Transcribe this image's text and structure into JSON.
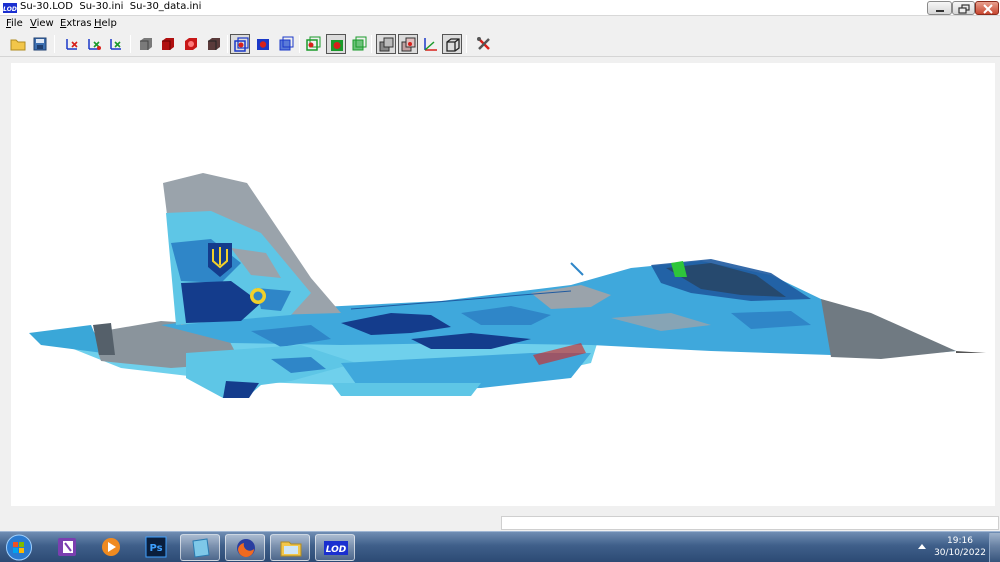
{
  "window": {
    "title": "Su-30.LOD  Su-30.ini  Su-30_data.ini",
    "app_badge": "LOD"
  },
  "menu": {
    "items": [
      {
        "label": "File"
      },
      {
        "label": "View"
      },
      {
        "label": "Extras"
      },
      {
        "label": "Help"
      }
    ]
  },
  "toolbar": {
    "buttons": [
      {
        "icon": "open-folder-icon"
      },
      {
        "icon": "save-disk-icon"
      },
      {
        "icon": "axis-x-icon"
      },
      {
        "icon": "axis-y-icon"
      },
      {
        "icon": "axis-z-icon"
      },
      {
        "icon": "cube-gray-icon"
      },
      {
        "icon": "cube-red-icon"
      },
      {
        "icon": "cube-red-alt-icon"
      },
      {
        "icon": "cube-dark-icon"
      },
      {
        "icon": "wire-cube-blue-icon",
        "pressed": true
      },
      {
        "icon": "wire-cube-blue-2-icon"
      },
      {
        "icon": "wire-cube-blue-3-icon"
      },
      {
        "icon": "wire-cube-green-icon"
      },
      {
        "icon": "wire-cube-green-2-icon",
        "pressed": true
      },
      {
        "icon": "wire-cube-green-3-icon"
      },
      {
        "icon": "layers-icon",
        "pressed": true
      },
      {
        "icon": "layers-red-icon",
        "pressed": true
      },
      {
        "icon": "axes-icon"
      },
      {
        "icon": "box-icon",
        "pressed": true
      },
      {
        "icon": "tools-icon"
      }
    ]
  },
  "viewport": {
    "model": "Su-30 aircraft with blue digital camouflage",
    "emblem_icon": "trident-emblem-icon"
  },
  "colors": {
    "camo_light": "#5ec6e6",
    "camo_mid": "#2f86c8",
    "camo_dark": "#143c8c",
    "camo_gray": "#9aa3ab",
    "nose_gray": "#707a82",
    "taskbar": "#3f5f8a"
  },
  "taskbar": {
    "apps": [
      {
        "icon": "onenote-icon"
      },
      {
        "icon": "media-player-icon"
      },
      {
        "icon": "photoshop-icon",
        "label": "Ps"
      },
      {
        "icon": "notes-icon"
      },
      {
        "icon": "firefox-icon"
      },
      {
        "icon": "file-explorer-icon"
      },
      {
        "icon": "lod-viewer-icon",
        "label": "LOD"
      }
    ],
    "clock": {
      "time": "19:16",
      "date": "30/10/2022"
    }
  }
}
